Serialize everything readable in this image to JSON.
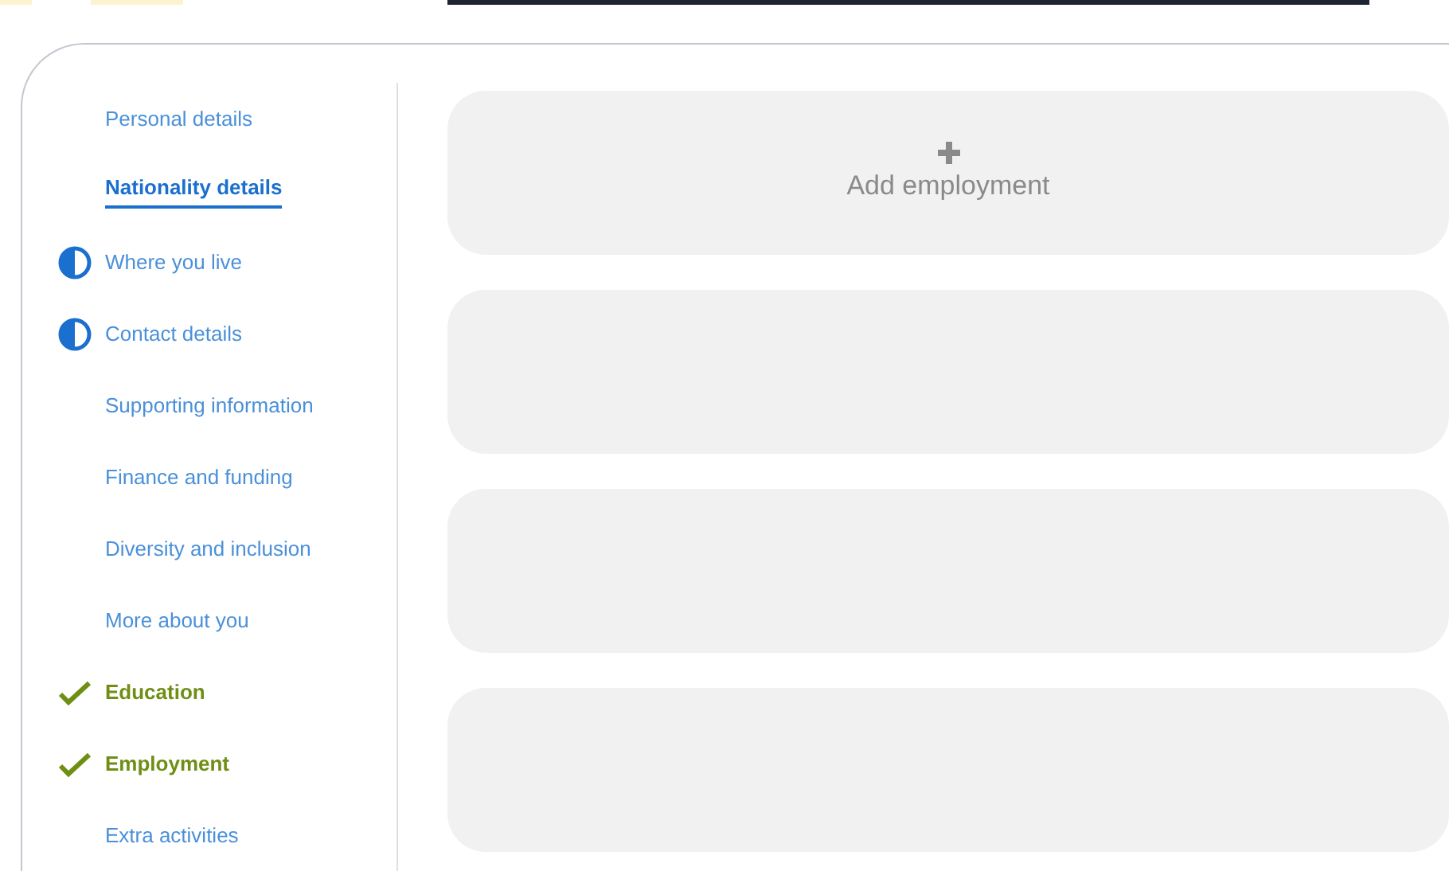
{
  "sidebar": {
    "items": [
      {
        "label": "Personal details",
        "selected": false,
        "in_progress": false,
        "complete": false
      },
      {
        "label": "Nationality details",
        "selected": true,
        "in_progress": false,
        "complete": false
      },
      {
        "label": "Where you live",
        "selected": false,
        "in_progress": true,
        "complete": false
      },
      {
        "label": "Contact details",
        "selected": false,
        "in_progress": true,
        "complete": false
      },
      {
        "label": "Supporting information",
        "selected": false,
        "in_progress": false,
        "complete": false
      },
      {
        "label": "Finance and funding",
        "selected": false,
        "in_progress": false,
        "complete": false
      },
      {
        "label": "Diversity and inclusion",
        "selected": false,
        "in_progress": false,
        "complete": false
      },
      {
        "label": "More about you",
        "selected": false,
        "in_progress": false,
        "complete": false
      },
      {
        "label": "Education",
        "selected": false,
        "in_progress": false,
        "complete": true
      },
      {
        "label": "Employment",
        "selected": false,
        "in_progress": false,
        "complete": true
      },
      {
        "label": "Extra activities",
        "selected": false,
        "in_progress": false,
        "complete": false
      }
    ]
  },
  "cards": [
    {
      "kind": "add",
      "label": "Add employment"
    },
    {
      "kind": "empty"
    },
    {
      "kind": "empty"
    },
    {
      "kind": "empty"
    }
  ]
}
